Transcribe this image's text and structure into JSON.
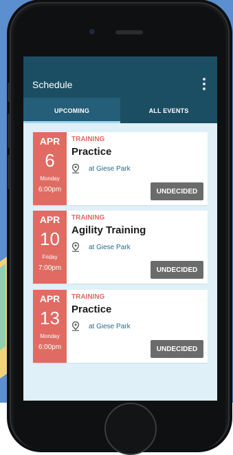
{
  "app": {
    "title": "Schedule"
  },
  "tabs": [
    {
      "label": "UPCOMING",
      "active": true
    },
    {
      "label": "ALL EVENTS",
      "active": false
    }
  ],
  "events": [
    {
      "month": "APR",
      "day": "6",
      "weekday": "Monday",
      "time": "6:00pm",
      "category": "TRAINING",
      "title": "Practice",
      "location": "at Giese Park",
      "status": "UNDECIDED"
    },
    {
      "month": "APR",
      "day": "10",
      "weekday": "Friday",
      "time": "7:00pm",
      "category": "TRAINING",
      "title": "Agility Training",
      "location": "at Giese Park",
      "status": "UNDECIDED"
    },
    {
      "month": "APR",
      "day": "13",
      "weekday": "Monday",
      "time": "6:00pm",
      "category": "TRAINING",
      "title": "Practice",
      "location": "at Giese Park",
      "status": "UNDECIDED"
    }
  ],
  "colors": {
    "appbar": "#1c4e63",
    "date_block": "#e06b62",
    "rsvp_button": "#6b6b6b",
    "screen_bg": "#dff0f8"
  },
  "icons": {
    "menu": "overflow-menu-icon",
    "location": "location-pin-icon"
  }
}
